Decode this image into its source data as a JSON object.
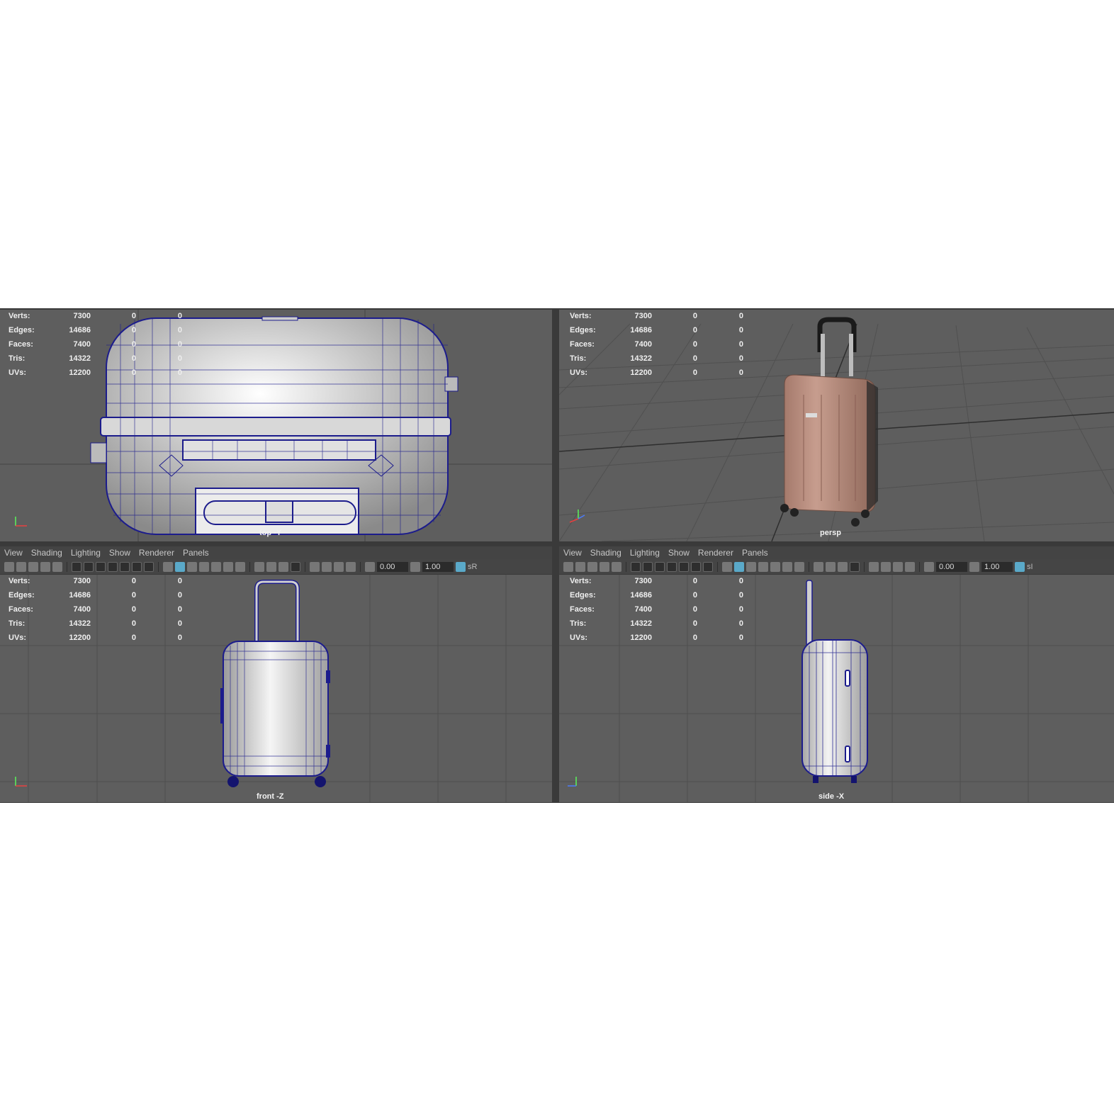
{
  "panel_menu": [
    "View",
    "Shading",
    "Lighting",
    "Show",
    "Renderer",
    "Panels"
  ],
  "toolbar": {
    "field_a": "0.00",
    "field_b": "1.00",
    "trail_left": "sR",
    "trail_right": "sI"
  },
  "hud": {
    "rows": [
      {
        "label": "Verts:",
        "v1": "7300",
        "v2": "0",
        "v3": "0"
      },
      {
        "label": "Edges:",
        "v1": "14686",
        "v2": "0",
        "v3": "0"
      },
      {
        "label": "Faces:",
        "v1": "7400",
        "v2": "0",
        "v3": "0"
      },
      {
        "label": "Tris:",
        "v1": "14322",
        "v2": "0",
        "v3": "0"
      },
      {
        "label": "UVs:",
        "v1": "12200",
        "v2": "0",
        "v3": "0"
      }
    ]
  },
  "viewports": {
    "top": {
      "camera": "top -Y"
    },
    "persp": {
      "camera": "persp"
    },
    "front": {
      "camera": "front -Z"
    },
    "side": {
      "camera": "side -X"
    }
  },
  "axis": {
    "x": "x",
    "y": "y",
    "z": "z"
  },
  "colors": {
    "wire": "#1c1c8c",
    "suitcase_pink": "#b58879",
    "viewport_bg": "#5e5e5e",
    "toolbar_accent": "#5aa9c9"
  }
}
